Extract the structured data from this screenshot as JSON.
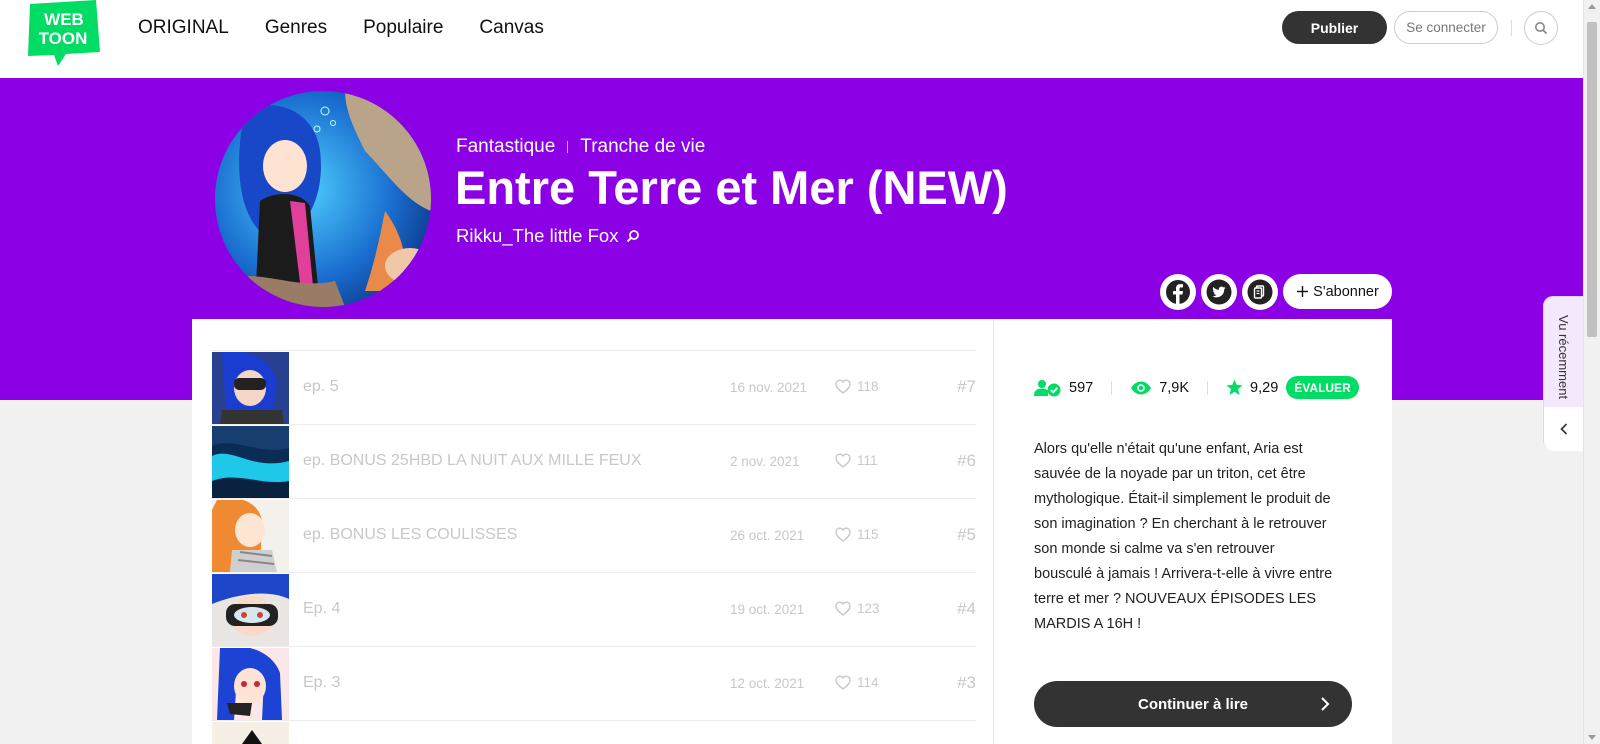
{
  "header": {
    "logo_line1": "WEB",
    "logo_line2": "TOON",
    "nav": [
      "ORIGINAL",
      "Genres",
      "Populaire",
      "Canvas"
    ],
    "publish_label": "Publier",
    "login_label": "Se connecter",
    "search_icon": "search-icon"
  },
  "series": {
    "genres": [
      "Fantastique",
      "Tranche de vie"
    ],
    "title": "Entre Terre et Mer (NEW)",
    "author": "Rikku_The little Fox",
    "subscribe_label": "S'abonner",
    "share_icons": [
      "facebook-icon",
      "twitter-icon",
      "copy-link-icon"
    ],
    "hero_color": "#8c00e6"
  },
  "episodes": [
    {
      "title": "ep. 5",
      "date": "16 nov. 2021",
      "likes": "118",
      "num": "#7"
    },
    {
      "title": "ep. BONUS 25HBD LA NUIT AUX MILLE FEUX",
      "date": "2 nov. 2021",
      "likes": "111",
      "num": "#6"
    },
    {
      "title": "ep. BONUS LES COULISSES",
      "date": "26 oct. 2021",
      "likes": "115",
      "num": "#5"
    },
    {
      "title": "Ep. 4",
      "date": "19 oct. 2021",
      "likes": "123",
      "num": "#4"
    },
    {
      "title": "Ep. 3",
      "date": "12 oct. 2021",
      "likes": "114",
      "num": "#3"
    }
  ],
  "stats": {
    "subscribers": "597",
    "views": "7,9K",
    "rating": "9,29",
    "rate_label": "ÉVALUER",
    "accent": "#00dc64"
  },
  "summary": "Alors qu'elle n'était qu'une enfant, Aria est sauvée de la noyade par un triton, cet être mythologique. Était-il simplement le produit de son imagination ? En cherchant à le retrouver son monde si calme va s'en retrouver bousculé à jamais ! Arrivera-t-elle à vivre entre terre et mer ? NOUVEAUX ÉPISODES LES MARDIS A 16H !",
  "continue_label": "Continuer à lire",
  "recent": {
    "label": "Vu récemment"
  }
}
